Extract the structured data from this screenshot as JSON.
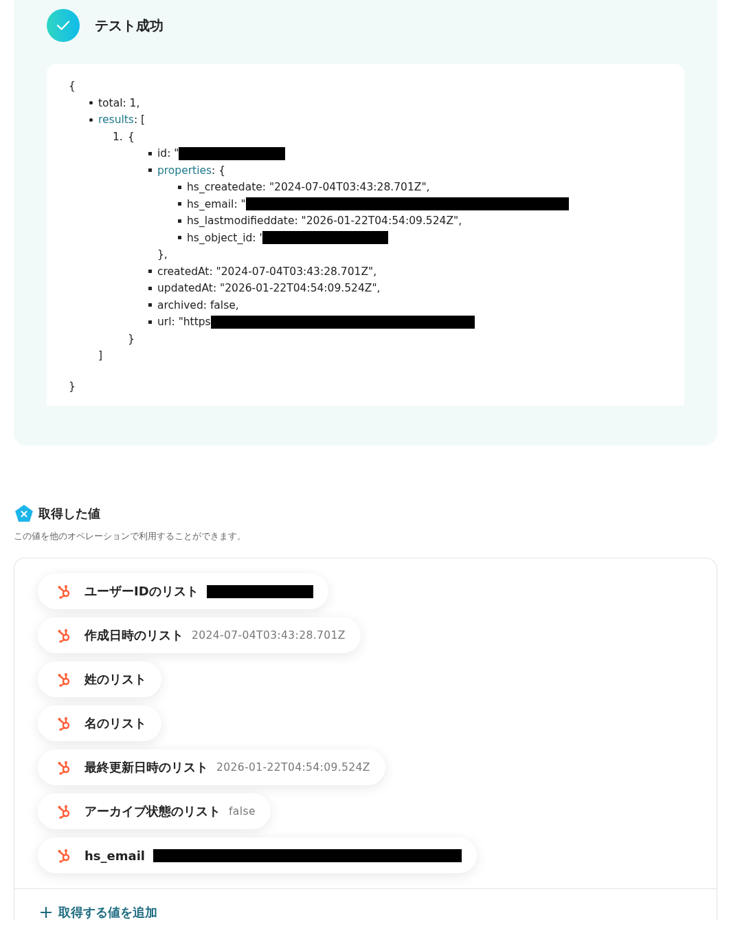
{
  "result": {
    "title": "テスト成功",
    "code": [
      {
        "text": "{",
        "children": [
          {
            "kind": "disc",
            "key": "total",
            "key_link": false,
            "text": ": 1,"
          },
          {
            "kind": "disc",
            "key": "results",
            "key_link": true,
            "text": ": [",
            "children": [
              {
                "kind": "number",
                "marker": "1.",
                "text": "{",
                "children": [
                  {
                    "kind": "square",
                    "key": "id",
                    "key_link": false,
                    "text": ": \"",
                    "redaction": {
                      "kind": "small"
                    }
                  },
                  {
                    "kind": "square",
                    "key": "properties",
                    "key_link": true,
                    "text": ": {",
                    "children": [
                      {
                        "kind": "square",
                        "key": "hs_createdate",
                        "key_link": false,
                        "text": ": \"2024-07-04T03:43:28.701Z\","
                      },
                      {
                        "kind": "square",
                        "key": "hs_email",
                        "key_link": false,
                        "text": ": \"",
                        "redaction": {
                          "kind": "xlarge"
                        }
                      },
                      {
                        "kind": "square",
                        "key": "hs_lastmodifieddate",
                        "key_link": false,
                        "text": ": \"2026-01-22T04:54:09.524Z\","
                      },
                      {
                        "kind": "square",
                        "key": "hs_object_id",
                        "key_link": false,
                        "text": ": '",
                        "redaction": {
                          "kind": "medium"
                        }
                      }
                    ]
                  },
                  {
                    "text": "},"
                  },
                  {
                    "kind": "square",
                    "key": "createdAt",
                    "key_link": false,
                    "text": ": \"2024-07-04T03:43:28.701Z\","
                  },
                  {
                    "kind": "square",
                    "key": "updatedAt",
                    "key_link": false,
                    "text": ": \"2026-01-22T04:54:09.524Z\","
                  },
                  {
                    "kind": "square",
                    "key": "archived",
                    "key_link": false,
                    "text": ": false,"
                  },
                  {
                    "kind": "square",
                    "key": "url",
                    "key_link": false,
                    "text": ": \"https",
                    "redaction": {
                      "kind": "large"
                    }
                  }
                ]
              },
              {
                "text": "}"
              }
            ]
          },
          {
            "text": "]"
          }
        ]
      },
      {
        "text": "}"
      }
    ]
  },
  "outputs": {
    "title": "取得した値",
    "description": "この値を他のオペレーションで利用することができます。",
    "items": [
      {
        "label": "ユーザーIDのリスト",
        "redaction": {
          "kind": "small"
        }
      },
      {
        "label": "作成日時のリスト",
        "value": "2024-07-04T03:43:28.701Z"
      },
      {
        "label": "姓のリスト"
      },
      {
        "label": "名のリスト"
      },
      {
        "label": "最終更新日時のリスト",
        "value": "2026-01-22T04:54:09.524Z"
      },
      {
        "label": "アーカイブ状態のリスト",
        "value": "false"
      },
      {
        "label": "hs_email",
        "redaction": {
          "kind": "wide"
        }
      }
    ],
    "add_button": "取得する値を追加"
  }
}
